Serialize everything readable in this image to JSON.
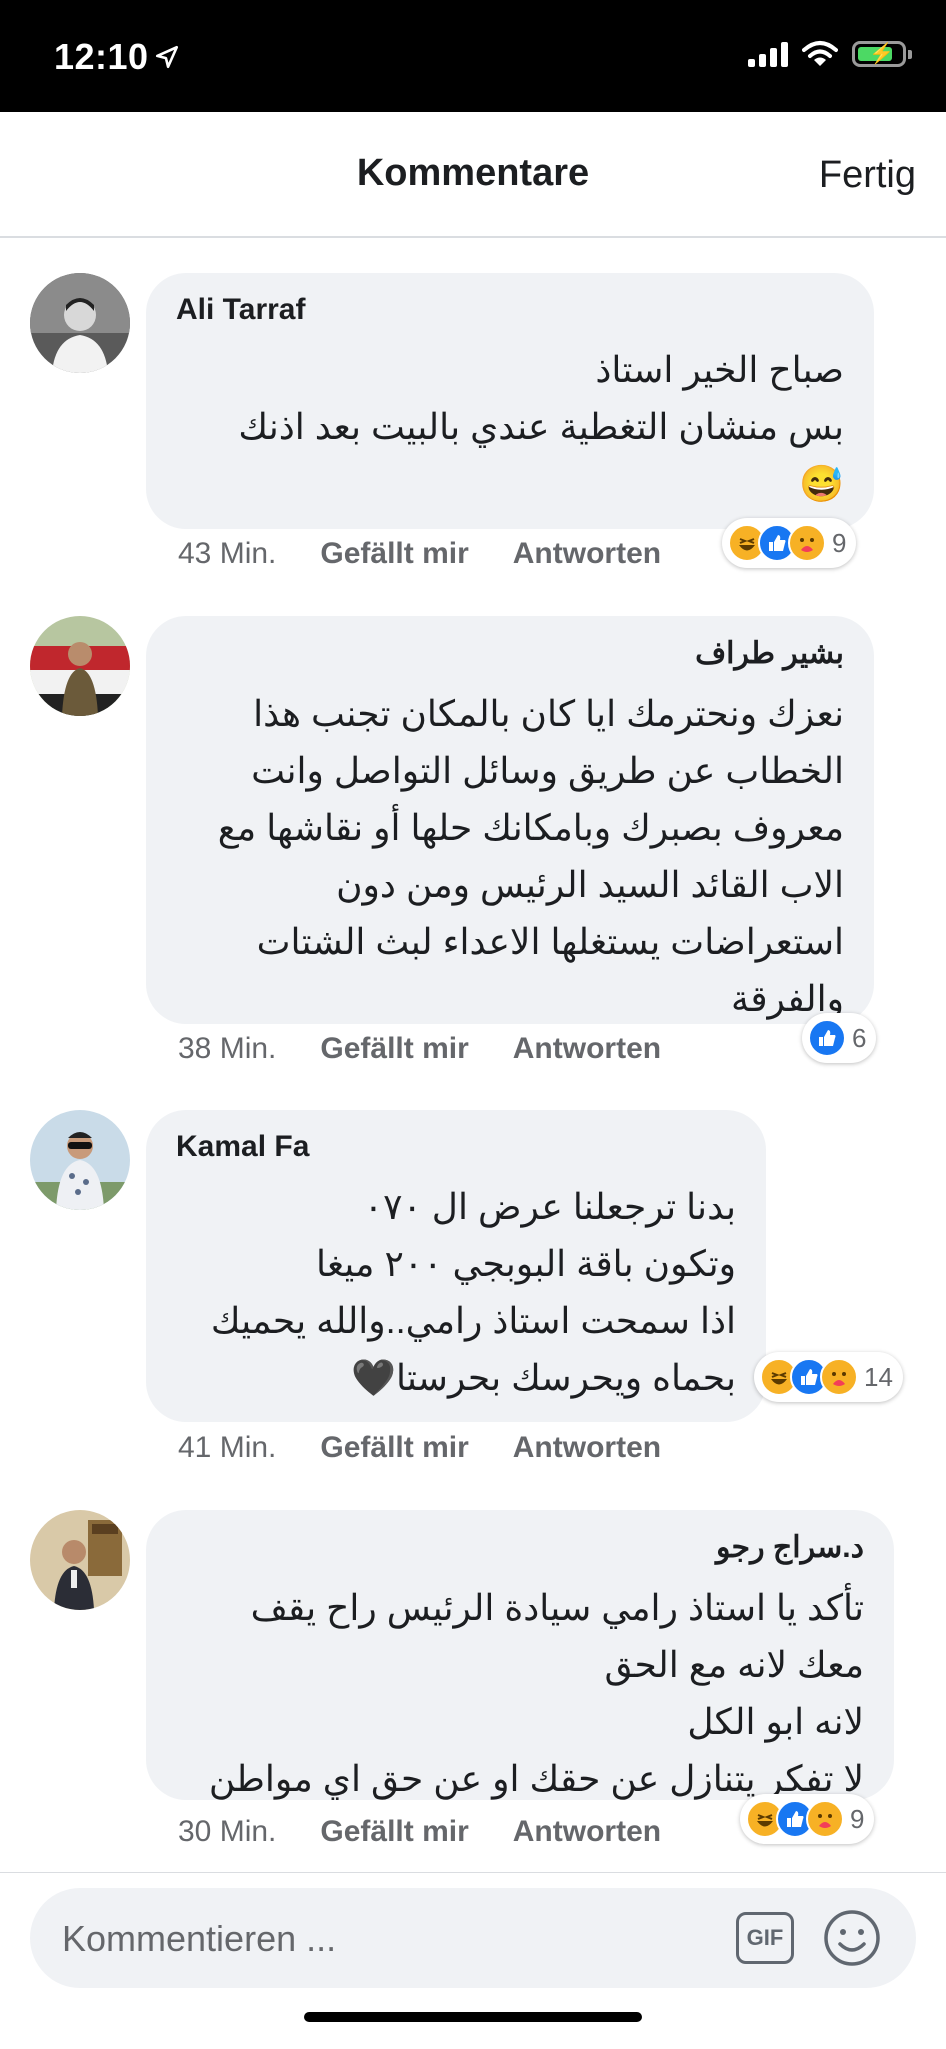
{
  "status_bar": {
    "time": "12:10"
  },
  "header": {
    "title": "Kommentare",
    "done_label": "Fertig"
  },
  "comments": [
    {
      "author": "Ali Tarraf",
      "text": "صباح الخير استاذ\nبس منشان التغطية عندي بالبيت بعد اذنك\n😅",
      "time": "43 Min.",
      "like_label": "Gefällt mir",
      "reply_label": "Antworten",
      "reactions": [
        "haha",
        "like",
        "care"
      ],
      "reaction_count": "9"
    },
    {
      "author": "بشير طراف",
      "text": "نعزك ونحترمك ايا كان بالمكان تجنب هذا\nالخطاب عن طريق وسائل التواصل وانت\nمعروف بصبرك وبامكانك حلها أو نقاشها مع\nالاب القائد السيد الرئيس ومن دون\nاستعراضات يستغلها الاعداء لبث الشتات\nوالفرقة",
      "time": "38 Min.",
      "like_label": "Gefällt mir",
      "reply_label": "Antworten",
      "reactions": [
        "like"
      ],
      "reaction_count": "6"
    },
    {
      "author": "Kamal Fa",
      "text": "بدنا ترجعلنا عرض ال ٠٧٠\nوتكون باقة البوبجي ٢٠٠ ميغا\nاذا سمحت استاذ رامي..والله يحميك\nبحماه ويحرسك بحرستا🖤",
      "time": "41 Min.",
      "like_label": "Gefällt mir",
      "reply_label": "Antworten",
      "reactions": [
        "haha",
        "like",
        "care"
      ],
      "reaction_count": "14"
    },
    {
      "author": "د.سراج رجو",
      "text": "تأكد يا استاذ رامي سيادة الرئيس راح يقف\nمعك لانه مع الحق\nلانه ابو الكل\nلا تفكر يتنازل عن حقك او عن حق اي مواطن",
      "time": "30 Min.",
      "like_label": "Gefällt mir",
      "reply_label": "Antworten",
      "reactions": [
        "haha",
        "like",
        "care"
      ],
      "reaction_count": "9"
    }
  ],
  "composer": {
    "placeholder": "Kommentieren ...",
    "gif_label": "GIF"
  },
  "colors": {
    "bubble": "#f0f2f5",
    "like_blue": "#1877f2",
    "haha_yellow": "#f7b125",
    "meta_gray": "#65676b"
  }
}
